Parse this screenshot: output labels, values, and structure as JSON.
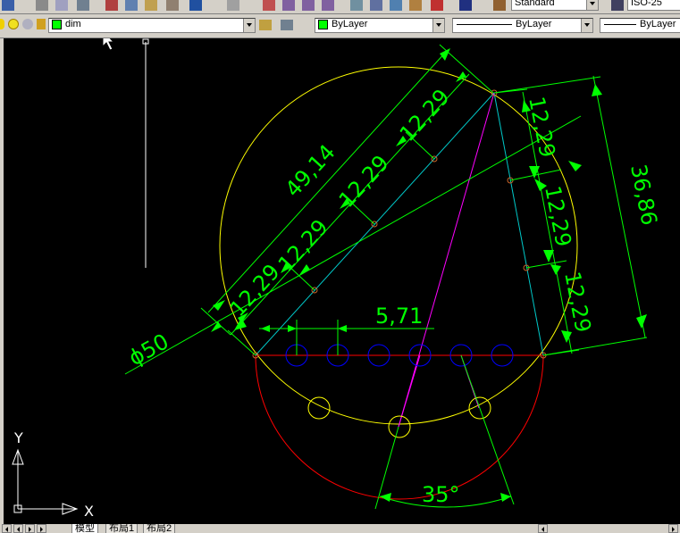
{
  "toolbar_top": {
    "text_style": "Standard",
    "dim_style": "ISO-25",
    "icons": [
      "save-icon",
      "print-icon",
      "preview-icon",
      "plot-icon",
      "cut-icon",
      "copy-icon",
      "paste-icon",
      "matchprop-icon",
      "undo-icon",
      "redo-icon",
      "pan-icon",
      "zoom-realtime-icon",
      "zoom-window-icon",
      "zoom-previous-icon",
      "properties-icon",
      "designcenter-icon",
      "toolpalette-icon",
      "markup-icon",
      "help-icon",
      "textstyle-icon",
      "dimstyle-icon"
    ]
  },
  "layers_toolbar": {
    "current_layer": "dim",
    "layer_color": "#00ff00",
    "layer_state_icons": [
      "layer-on-bulb-icon",
      "layer-freeze-sun-icon",
      "layer-lock-icon"
    ]
  },
  "properties_toolbar": {
    "color": "ByLayer",
    "color_swatch": "#00ff00",
    "linetype": "ByLayer",
    "lineweight": "ByLayer"
  },
  "drawing": {
    "dimensions": {
      "diameter": "ϕ50",
      "length_49": "49,14",
      "seg1": "12,29",
      "seg2": "12,29",
      "seg3": "12,29",
      "seg4": "12,29",
      "rseg1": "12,29",
      "rseg2": "12,29",
      "rseg3": "12,29",
      "vertical": "36,86",
      "spacing": "5,71",
      "angle": "35°"
    },
    "colors": {
      "circle": "#ffff00",
      "dim": "#00ff00",
      "construction": "#00c8c8",
      "magenta": "#ff00ff",
      "arc": "#ff0000",
      "holes": "#0000ff",
      "points": "#c86428",
      "ucs": "#ffffff"
    },
    "ucs": {
      "x_label": "X",
      "y_label": "Y"
    }
  },
  "layout_tabs": [
    "模型",
    "布局1",
    "布局2"
  ]
}
